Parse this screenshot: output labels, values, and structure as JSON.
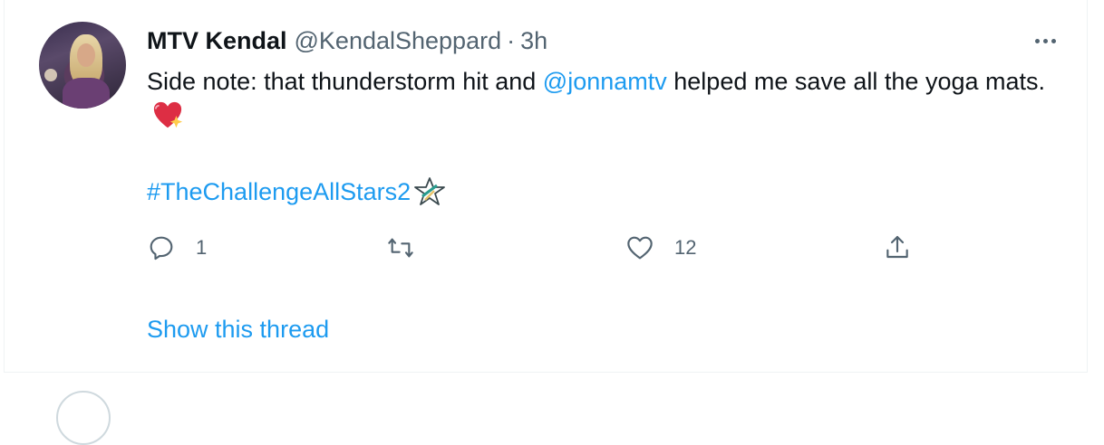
{
  "tweet": {
    "author_name": "MTV Kendal",
    "author_handle": "@KendalSheppard",
    "separator": "·",
    "time": "3h",
    "text_part1": "Side note: that thunderstorm hit and ",
    "mention": "@jonnamtv",
    "text_part2": " helped me save all the yoga mats.",
    "hashtag": "#TheChallengeAllStars2",
    "reply_count": "1",
    "retweet_count": "",
    "like_count": "12",
    "show_thread": "Show this thread"
  },
  "icons": {
    "more": "more-dots-icon",
    "reply": "reply-icon",
    "retweet": "retweet-icon",
    "like": "heart-icon",
    "share": "share-icon",
    "emoji": "sparkling-heart-emoji",
    "hashflag": "challenge-star-hashflag"
  },
  "colors": {
    "link": "#1d9bf0",
    "secondary_text": "#536471",
    "primary_text": "#0f1419"
  }
}
